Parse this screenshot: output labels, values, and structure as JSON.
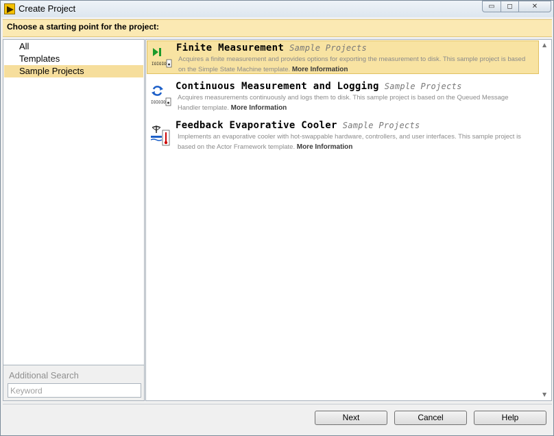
{
  "window": {
    "title": "Create Project",
    "controls": {
      "minimize": "▭",
      "maximize": "◻",
      "close": "✕"
    }
  },
  "header": {
    "prompt": "Choose a starting point for the project:"
  },
  "categories": [
    {
      "label": "All",
      "selected": false
    },
    {
      "label": "Templates",
      "selected": false
    },
    {
      "label": "Sample Projects",
      "selected": true
    }
  ],
  "search": {
    "label": "Additional Search",
    "placeholder": "Keyword"
  },
  "projects": [
    {
      "title": "Finite Measurement",
      "tag": "Sample Projects",
      "description": "Acquires a finite measurement and provides options for exporting the measurement to disk. This sample project is based on the Simple State Machine template.",
      "more": "More Information",
      "icon": "play-stop-io-icon",
      "selected": true
    },
    {
      "title": "Continuous Measurement and Logging",
      "tag": "Sample Projects",
      "description": "Acquires measurements continuously and logs them to disk. This sample project is based on the Queued Message Handler template.",
      "more": "More Information",
      "icon": "refresh-io-icon",
      "selected": false
    },
    {
      "title": "Feedback Evaporative Cooler",
      "tag": "Sample Projects",
      "description": "Implements an evaporative cooler with hot-swappable hardware, controllers, and user interfaces. This sample project is based on the Actor Framework template.",
      "more": "More Information",
      "icon": "cooler-thermometer-icon",
      "selected": false
    }
  ],
  "buttons": {
    "next": "Next",
    "cancel": "Cancel",
    "help": "Help"
  },
  "colors": {
    "banner": "#fbe9b3",
    "selection": "#f8e3a2",
    "accent_green": "#1a9a2a",
    "accent_blue": "#1c5fc8"
  }
}
